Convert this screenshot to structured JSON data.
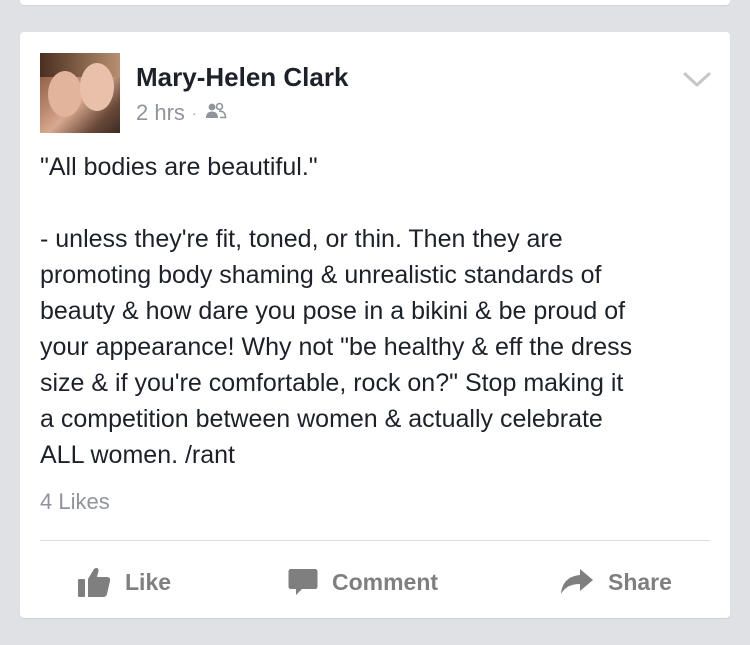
{
  "post": {
    "author": "Mary-Helen Clark",
    "timestamp": "2 hrs",
    "separator": "·",
    "audience_icon": "friends-icon",
    "menu_icon": "chevron-down-icon",
    "text_lines": [
      "\"All bodies are beautiful.\"",
      "",
      "- unless they're fit, toned, or thin. Then they are",
      "promoting body shaming & unrealistic standards of",
      "beauty & how dare you pose in a bikini & be proud of",
      "your appearance! Why not \"be healthy & eff the dress",
      "size & if you're comfortable, rock on?\" Stop making it",
      "a competition between women & actually celebrate",
      "ALL women. /rant"
    ],
    "likes": "4 Likes"
  },
  "actions": {
    "like_label": "Like",
    "comment_label": "Comment",
    "share_label": "Share"
  },
  "colors": {
    "background": "#dfe1e5",
    "text": "#1d2129",
    "secondary_text": "#90949c",
    "action_text": "#7f7f7f"
  }
}
